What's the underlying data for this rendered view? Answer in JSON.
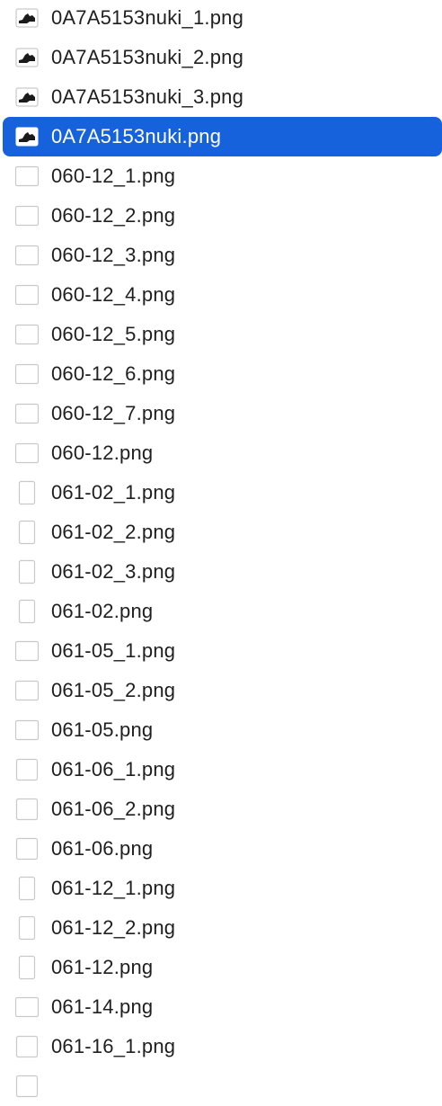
{
  "file_list": {
    "selected_index": 3,
    "items": [
      {
        "name": "0A7A5153nuki_1.png",
        "icon": "image-thumbnail-icon",
        "thumb": "dark-wide"
      },
      {
        "name": "0A7A5153nuki_2.png",
        "icon": "image-thumbnail-icon",
        "thumb": "dark-wide"
      },
      {
        "name": "0A7A5153nuki_3.png",
        "icon": "image-thumbnail-icon",
        "thumb": "dark-wide"
      },
      {
        "name": "0A7A5153nuki.png",
        "icon": "image-thumbnail-icon",
        "thumb": "dark-wide"
      },
      {
        "name": "060-12_1.png",
        "icon": "blank-image-icon",
        "thumb": "wide"
      },
      {
        "name": "060-12_2.png",
        "icon": "blank-image-icon",
        "thumb": "wide"
      },
      {
        "name": "060-12_3.png",
        "icon": "blank-image-icon",
        "thumb": "wide"
      },
      {
        "name": "060-12_4.png",
        "icon": "blank-image-icon",
        "thumb": "wide"
      },
      {
        "name": "060-12_5.png",
        "icon": "blank-image-icon",
        "thumb": "wide"
      },
      {
        "name": "060-12_6.png",
        "icon": "blank-image-icon",
        "thumb": "wide"
      },
      {
        "name": "060-12_7.png",
        "icon": "blank-image-icon",
        "thumb": "wide"
      },
      {
        "name": "060-12.png",
        "icon": "blank-image-icon",
        "thumb": "wide"
      },
      {
        "name": "061-02_1.png",
        "icon": "blank-image-icon",
        "thumb": "tall"
      },
      {
        "name": "061-02_2.png",
        "icon": "blank-image-icon",
        "thumb": "tall"
      },
      {
        "name": "061-02_3.png",
        "icon": "blank-image-icon",
        "thumb": "tall"
      },
      {
        "name": "061-02.png",
        "icon": "blank-image-icon",
        "thumb": "tall"
      },
      {
        "name": "061-05_1.png",
        "icon": "blank-image-icon",
        "thumb": "wide"
      },
      {
        "name": "061-05_2.png",
        "icon": "blank-image-icon",
        "thumb": "wide"
      },
      {
        "name": "061-05.png",
        "icon": "blank-image-icon",
        "thumb": "wide"
      },
      {
        "name": "061-06_1.png",
        "icon": "blank-image-icon",
        "thumb": "square"
      },
      {
        "name": "061-06_2.png",
        "icon": "blank-image-icon",
        "thumb": "square"
      },
      {
        "name": "061-06.png",
        "icon": "blank-image-icon",
        "thumb": "square"
      },
      {
        "name": "061-12_1.png",
        "icon": "blank-image-icon",
        "thumb": "tall"
      },
      {
        "name": "061-12_2.png",
        "icon": "blank-image-icon",
        "thumb": "tall"
      },
      {
        "name": "061-12.png",
        "icon": "blank-image-icon",
        "thumb": "tall"
      },
      {
        "name": "061-14.png",
        "icon": "blank-image-icon",
        "thumb": "wide"
      },
      {
        "name": "061-16_1.png",
        "icon": "blank-image-icon",
        "thumb": "square"
      },
      {
        "name": "",
        "icon": "blank-image-icon",
        "thumb": "square"
      }
    ]
  },
  "colors": {
    "selection": "#1662dc",
    "text": "#1f1f1f",
    "selected_text": "#ffffff"
  }
}
